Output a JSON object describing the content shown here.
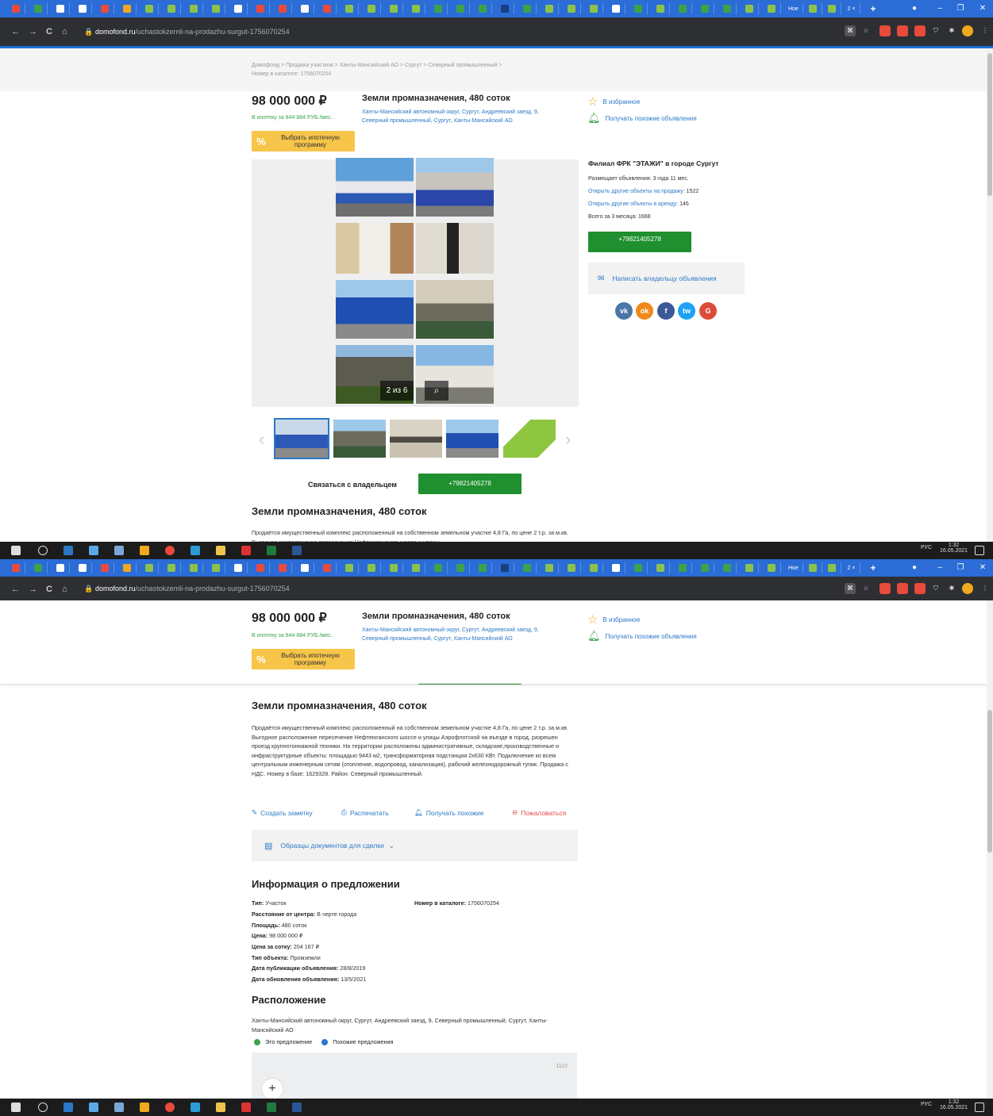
{
  "browser": {
    "url_domain": "domofond.ru",
    "url_path": "/uchastokzemli-na-prodazhu-surgut-1756070254",
    "tab_labels": {
      "hoe": "Hoe",
      "active_count": "2 ×"
    }
  },
  "breadcrumb": {
    "text": "Домофонд > Продажа участков > Ханты-Мансийский АО > Сургут > Северный промышленный >",
    "catalog": "Номер в каталоге: 1756070254"
  },
  "listing": {
    "price": "98 000 000 ₽",
    "mortgage_text": "В ипотеку за 844 884 РУБ./мес.",
    "mortgage_button": "Выбрать ипотечную программу",
    "mortgage_icon": "%",
    "title": "Земли промназначения, 480 соток",
    "address": "Ханты-Мансийский автономный округ, Сургут, Андреевский заезд, 9, Северный промышленный, Сургут, Ханты-Мансийский АО",
    "favorite": "В избранное",
    "similar": "Получать похожие объявления"
  },
  "gallery": {
    "counter": "2 из 6",
    "zoom_icon": "magnifier-icon"
  },
  "contact": {
    "label": "Связаться с владельцем",
    "phone": "+79821405278"
  },
  "agency": {
    "title": "Филиал ФРК \"ЭТАЖИ\" в городе Сургут",
    "posting": "Размещает объявления: 3 года 11 мес.",
    "sale_link": "Открыть другие объекты на продажу:",
    "sale_count": "1522",
    "rent_link": "Открыть другие объекты в аренду:",
    "rent_count": "146",
    "last3_label": "Всего за 3 месяца:",
    "last3": "1668",
    "phone": "+79821405278",
    "write": "Написать владельцу объявления",
    "social": [
      "vk",
      "ok",
      "f",
      "tw",
      "G"
    ]
  },
  "description": {
    "heading": "Земли промназначения, 480 соток",
    "text": "Продаётся имущественный комплекс расположенный на собственном земельном участке 4,8 Га, по цене 2 т.р. за м.кв. Выгодное расположение пересечение Нефтеюганского шоссе и улицы Аэрофлотской на въезде в город, разрешен проезд крупнотоннажной техники. На территории расположены административные, складские,производственные и инфраструктурные объекты: площадью 9443 м2, трансформаторная подстанция 2х630 КВт. Подключение ко всем центральным инженерным сетям (отопление, водопровод, канализация), рабочий железнодорожный тупик. Продажа с НДС. Номер в базе: 1629328. Район: Северный промышленный.",
    "text_cut": "Продаётся имущественный комплекс расположенный на собственном земельном участке 4,8 Га, по цене 2 т.р. за м.кв. Выгодное расположение пересечение Нефтеюганского шоссе и улицы"
  },
  "actions": {
    "note": "Создать заметку",
    "print": "Распечатать",
    "similar": "Получать похожие",
    "complain": "Пожаловаться",
    "docs": "Образцы документов для сделки"
  },
  "info": {
    "heading": "Информация о предложении",
    "rows": [
      {
        "k": "Тип:",
        "v": " Участок"
      },
      {
        "k": "Расстояние от центра:",
        "v": " В черте города"
      },
      {
        "k": "Площадь:",
        "v": " 480 соток"
      },
      {
        "k": "Цена:",
        "v": " 98 000 000 ₽"
      },
      {
        "k": "Цена за сотку:",
        "v": " 204 167 ₽"
      },
      {
        "k": "Тип объекта:",
        "v": " Промземли"
      },
      {
        "k": "Дата публикации объявления:",
        "v": " 28/8/2019"
      },
      {
        "k": "Дата обновления объявления:",
        "v": " 13/5/2021"
      }
    ],
    "catalog_k": "Номер в каталоге:",
    "catalog_v": " 1756070254"
  },
  "location": {
    "heading": "Расположение",
    "address": "Ханты-Мансийский автономный округ, Сургут, Андреевский заезд, 9, Северный промышленный, Сургут, Ханты-Мансийский АО",
    "legend_this": "Это предложение",
    "legend_similar": "Похожие предложения",
    "map_label": "11с2",
    "zoom_in": "+"
  },
  "taskbar": {
    "lang": "РУС",
    "time": "1:32",
    "date": "16.05.2021"
  },
  "colors": {
    "accent": "#2b78c6",
    "green": "#1f8f2f",
    "yellow": "#f7c54a",
    "tabs": "#2b6cd6"
  }
}
